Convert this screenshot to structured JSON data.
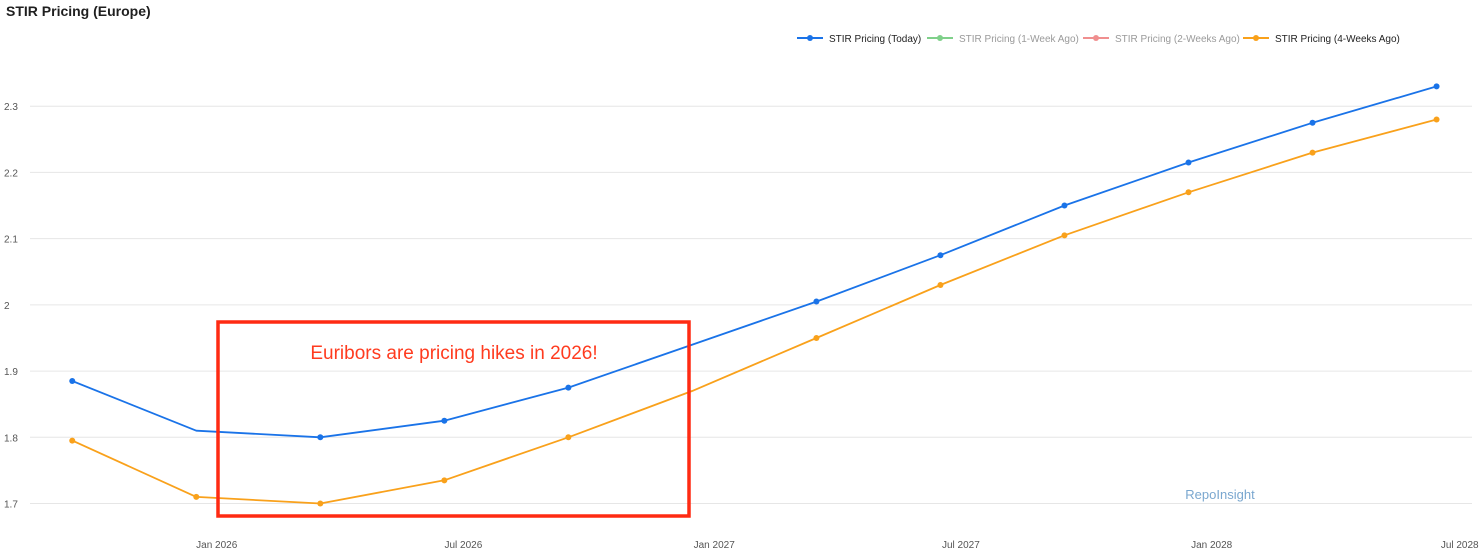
{
  "title": "STIR Pricing (Europe)",
  "watermark": "RepoInsight",
  "annotation": {
    "text": "Euribors are pricing hikes in 2026!",
    "color": "#ff2a12"
  },
  "colors": {
    "grid": "#e6e6e6",
    "axis_text": "#555555"
  },
  "chart_data": {
    "type": "line",
    "title": "STIR Pricing (Europe)",
    "xlabel": "",
    "ylabel": "",
    "x": [
      "2025-09-17",
      "2025-12-17",
      "2026-03-18",
      "2026-06-17",
      "2026-09-16",
      "2026-12-16",
      "2027-03-17",
      "2027-06-16",
      "2027-09-15",
      "2027-12-15",
      "2028-03-15",
      "2028-06-14"
    ],
    "x_ticks": [
      "Jan 2026",
      "Jul 2026",
      "Jan 2027",
      "Jul 2027",
      "Jan 2028",
      "Jul 2028"
    ],
    "x_tick_dates": [
      "2026-01-01",
      "2026-07-01",
      "2027-01-01",
      "2027-07-01",
      "2028-01-01",
      "2028-07-01"
    ],
    "xlim": [
      "2025-08-17",
      "2028-07-10"
    ],
    "ylim": [
      1.66,
      2.4
    ],
    "y_ticks": [
      1.7,
      1.8,
      1.9,
      2,
      2.1,
      2.2,
      2.3
    ],
    "y_tick_labels": [
      "1.7",
      "1.8",
      "1.9",
      "2",
      "2.1",
      "2.2",
      "2.3"
    ],
    "grid": true,
    "legend_position": "top-right",
    "series": [
      {
        "name": "STIR Pricing (Today)",
        "color": "#1a73e8",
        "visible": true,
        "values": [
          1.885,
          1.81,
          1.8,
          1.825,
          1.875,
          1.94,
          2.005,
          2.075,
          2.15,
          2.215,
          2.275,
          2.33
        ],
        "markers": [
          true,
          false,
          true,
          true,
          true,
          false,
          true,
          true,
          true,
          true,
          true,
          true
        ]
      },
      {
        "name": "STIR Pricing (1-Week Ago)",
        "color": "#7fd08a",
        "visible": false,
        "values": []
      },
      {
        "name": "STIR Pricing (2-Weeks Ago)",
        "color": "#f08f8f",
        "visible": false,
        "values": []
      },
      {
        "name": "STIR Pricing (4-Weeks Ago)",
        "color": "#f9a11b",
        "visible": true,
        "values": [
          1.795,
          1.71,
          1.7,
          1.735,
          1.8,
          1.87,
          1.95,
          2.03,
          2.105,
          2.17,
          2.23,
          2.28
        ],
        "markers": [
          true,
          true,
          true,
          true,
          true,
          false,
          true,
          true,
          true,
          true,
          true,
          true
        ]
      }
    ]
  }
}
